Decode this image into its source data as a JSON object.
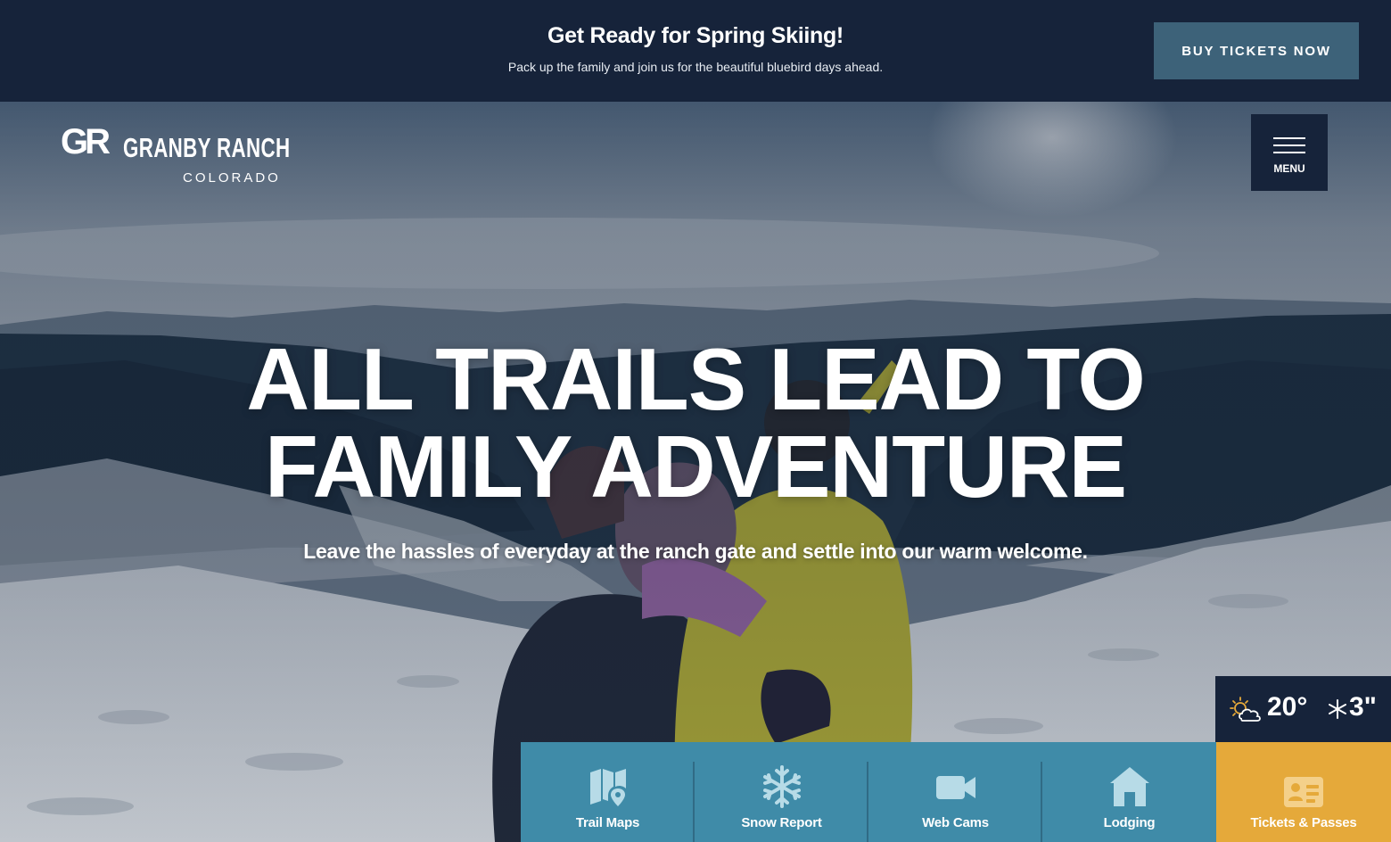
{
  "promo": {
    "title": "Get Ready for Spring Skiing!",
    "subtitle": "Pack up the family and join us for the beautiful bluebird days ahead.",
    "button_label": "BUY TICKETS NOW"
  },
  "logo": {
    "mark": "GR",
    "name": "GRANBY RANCH",
    "region": "COLORADO"
  },
  "menu": {
    "label": "MENU"
  },
  "hero": {
    "headline_line1": "ALL TRAILS LEAD TO",
    "headline_line2": "FAMILY ADVENTURE",
    "tagline": "Leave the hassles of everyday at the ranch gate and settle into our warm welcome."
  },
  "weather": {
    "icon": "partly-sunny-icon",
    "temperature": "20°",
    "snow_icon": "snowflake-icon",
    "snowfall": "3\""
  },
  "quick_links": [
    {
      "label": "Trail Maps",
      "icon": "map-pin-icon"
    },
    {
      "label": "Snow Report",
      "icon": "snowflake-icon"
    },
    {
      "label": "Web Cams",
      "icon": "video-camera-icon"
    },
    {
      "label": "Lodging",
      "icon": "house-icon"
    },
    {
      "label": "Tickets & Passes",
      "icon": "ticket-card-icon"
    }
  ],
  "colors": {
    "navy": "#16233a",
    "slate_button": "#3d6279",
    "teal": "#3f8ba8",
    "gold": "#e5a93a",
    "icon_light": "#b7dbe7"
  }
}
